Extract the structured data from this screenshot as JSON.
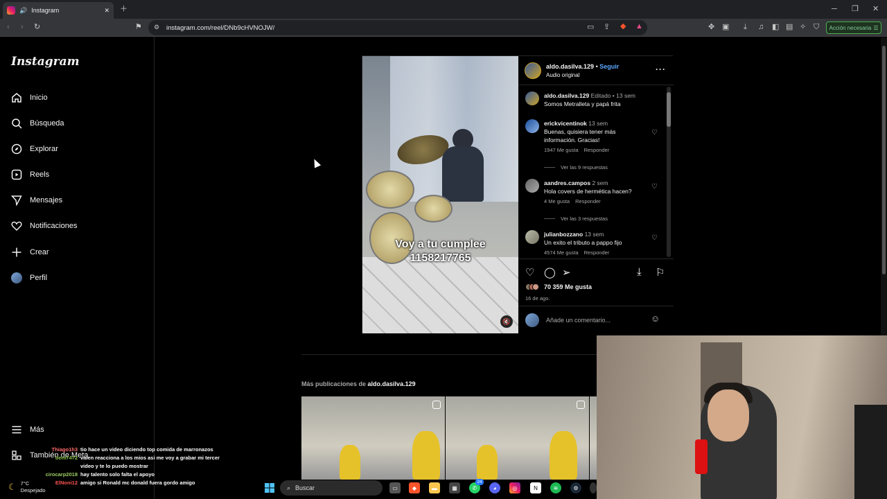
{
  "browser": {
    "tab_title": "Instagram",
    "url": "instagram.com/reel/DNb9cHVNOJW/",
    "action_button": "Acción necesaria"
  },
  "sidebar": {
    "logo": "Instagram",
    "items": [
      {
        "label": "Inicio",
        "icon": "home-icon"
      },
      {
        "label": "Búsqueda",
        "icon": "search-icon"
      },
      {
        "label": "Explorar",
        "icon": "compass-icon"
      },
      {
        "label": "Reels",
        "icon": "reels-icon"
      },
      {
        "label": "Mensajes",
        "icon": "send-icon"
      },
      {
        "label": "Notificaciones",
        "icon": "heart-icon"
      },
      {
        "label": "Crear",
        "icon": "plus-icon"
      },
      {
        "label": "Perfil",
        "icon": "avatar-icon"
      }
    ],
    "more": "Más",
    "meta": "También de Meta"
  },
  "post": {
    "video_overlay_line1": "Voy a tu cumplee",
    "video_overlay_line2": "1158217765",
    "author": "aldo.dasilva.129",
    "separator": "•",
    "follow": "Seguir",
    "audio": "Audio original",
    "comments": [
      {
        "user": "aldo.dasilva.129",
        "edited": "Editado •",
        "time": "13 sem",
        "text": "Somos Metralleta y papá frita",
        "likes": "",
        "reply": ""
      },
      {
        "user": "erickvicentinok",
        "edited": "",
        "time": "13 sem",
        "text": "Buenas, quisiera tener más información. Gracias!",
        "likes": "1947 Me gusta",
        "reply": "Responder"
      },
      {
        "user": "aandres.campos",
        "edited": "",
        "time": "2 sem",
        "text": "Hola covers de hermética hacen?",
        "likes": "4 Me gusta",
        "reply": "Responder"
      },
      {
        "user": "julianbozzano",
        "edited": "",
        "time": "13 sem",
        "text": "Un exito el tributo a pappo fijo",
        "likes": "4574 Me gusta",
        "reply": "Responder"
      }
    ],
    "replies_1": "Ver las 9 respuestas",
    "replies_2": "Ver las 3 respuestas",
    "like_count": "70 359 Me gusta",
    "date": "16 de ago.",
    "comment_placeholder": "Añade un comentario..."
  },
  "more_posts": {
    "prefix": "Más publicaciones de",
    "user": "aldo.dasilva.129"
  },
  "chat": [
    {
      "user": "Thiago1h3",
      "msg": "tio hace un video diciendo top comida de marronazos",
      "color": "#ff6b6b"
    },
    {
      "user": "beni7472",
      "msg": "valen reacciona a los mios asi me voy a grabar mi tercer video y te lo puedo mostrar",
      "color": "#8bc34a"
    },
    {
      "user": "cirocarp2018",
      "msg": "hay talento solo falta el apoyo",
      "color": "#9ccc65"
    },
    {
      "user": "ElNoni12",
      "msg": "amigo si Ronald mc donald fuera gordo amigo",
      "color": "#ff5252"
    }
  ],
  "taskbar": {
    "temp": "7°C",
    "weather": "Despejado",
    "search": "Buscar",
    "badge": "24"
  }
}
